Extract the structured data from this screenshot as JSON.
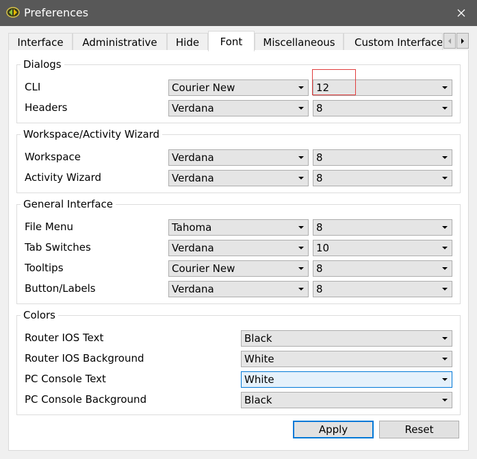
{
  "window": {
    "title": "Preferences",
    "icon": "packet-tracer-app-icon",
    "close_icon": "close-icon"
  },
  "tabs": [
    {
      "label": "Interface"
    },
    {
      "label": "Administrative"
    },
    {
      "label": "Hide"
    },
    {
      "label": "Font",
      "active": true
    },
    {
      "label": "Miscellaneous"
    },
    {
      "label": "Custom Interface"
    }
  ],
  "tab_scroll": {
    "left_icon": "chevron-left-icon",
    "right_icon": "chevron-right-icon"
  },
  "groups": {
    "dialogs": {
      "title": "Dialogs",
      "rows": [
        {
          "label": "CLI",
          "font": "Courier New",
          "size": "12"
        },
        {
          "label": "Headers",
          "font": "Verdana",
          "size": "8"
        }
      ]
    },
    "workspace": {
      "title": "Workspace/Activity Wizard",
      "rows": [
        {
          "label": "Workspace",
          "font": "Verdana",
          "size": "8"
        },
        {
          "label": "Activity Wizard",
          "font": "Verdana",
          "size": "8"
        }
      ]
    },
    "general": {
      "title": "General Interface",
      "rows": [
        {
          "label": "File Menu",
          "font": "Tahoma",
          "size": "8"
        },
        {
          "label": "Tab Switches",
          "font": "Verdana",
          "size": "10"
        },
        {
          "label": "Tooltips",
          "font": "Courier New",
          "size": "8"
        },
        {
          "label": "Button/Labels",
          "font": "Verdana",
          "size": "8"
        }
      ]
    },
    "colors": {
      "title": "Colors",
      "rows": [
        {
          "label": "Router IOS Text",
          "value": "Black"
        },
        {
          "label": "Router IOS Background",
          "value": "White"
        },
        {
          "label": "PC Console Text",
          "value": "White"
        },
        {
          "label": "PC Console Background",
          "value": "Black"
        }
      ]
    }
  },
  "buttons": {
    "apply": "Apply",
    "reset": "Reset"
  },
  "colors": {
    "titlebar": "#585858",
    "focus": "#0078d7",
    "highlight": "#e03a3a"
  }
}
